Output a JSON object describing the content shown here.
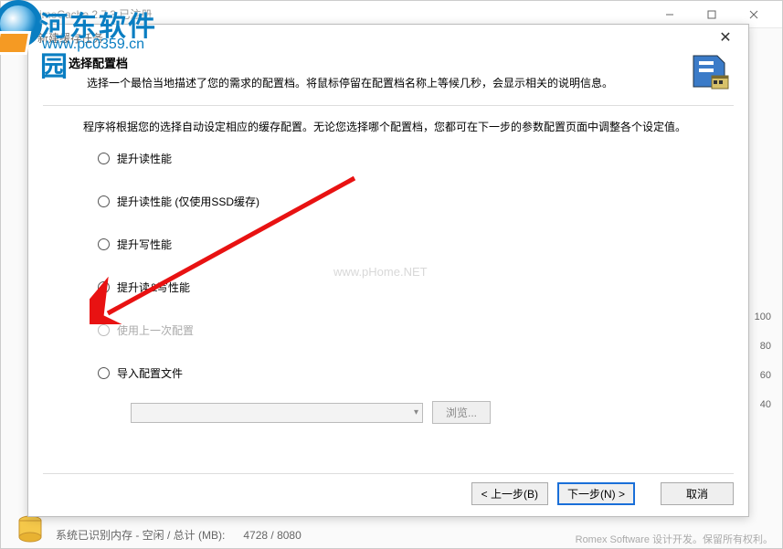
{
  "parent": {
    "title": "PrimoCache 2.7.3    已注册",
    "memline_prefix": "系统已识别内存 - 空闲 / 总计 (MB):",
    "mem_free": "4728",
    "mem_total": "8080",
    "footer": "Romex Software 设计开发。保留所有权利。",
    "chart_labels": [
      "100",
      "80",
      "60",
      "40"
    ]
  },
  "watermark": {
    "text": "河东软件园",
    "url": "www.pc0359.cn"
  },
  "center_wm": "www.pHome.NET",
  "dialog": {
    "title": "新建缓存任务",
    "header_title": "选择配置档",
    "header_desc": "选择一个最恰当地描述了您的需求的配置档。将鼠标停留在配置档名称上等候几秒，会显示相关的说明信息。",
    "content_hint": "程序将根据您的选择自动设定相应的缓存配置。无论您选择哪个配置档，您都可在下一步的参数配置页面中调整各个设定值。",
    "options": {
      "opt1": "提升读性能",
      "opt2": "提升读性能 (仅使用SSD缓存)",
      "opt3": "提升写性能",
      "opt4": "提升读&写性能",
      "opt5": "使用上一次配置",
      "opt6": "导入配置文件"
    },
    "browse": "浏览...",
    "buttons": {
      "back": "< 上一步(B)",
      "next": "下一步(N) >",
      "cancel": "取消"
    }
  }
}
